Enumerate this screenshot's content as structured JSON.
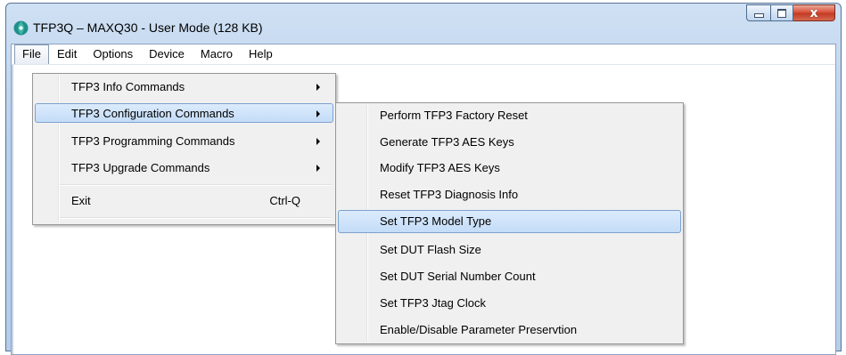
{
  "window": {
    "title": "TFP3Q – MAXQ30 - User Mode (128 KB)",
    "icon": "app-logo-icon",
    "buttons": {
      "minimize": "minimize-icon",
      "maximize": "maximize-icon",
      "close": "close-icon"
    },
    "close_glyph": "x"
  },
  "menubar": {
    "items": [
      {
        "label": "File",
        "active": true
      },
      {
        "label": "Edit"
      },
      {
        "label": "Options"
      },
      {
        "label": "Device"
      },
      {
        "label": "Macro"
      },
      {
        "label": "Help"
      }
    ]
  },
  "file_menu": {
    "items": [
      {
        "label": "TFP3 Info Commands",
        "has_submenu": true
      },
      {
        "label": "TFP3 Configuration Commands",
        "has_submenu": true,
        "highlighted": true
      },
      {
        "label": "TFP3 Programming Commands",
        "has_submenu": true
      },
      {
        "label": "TFP3 Upgrade Commands",
        "has_submenu": true
      },
      {
        "label": "Exit",
        "shortcut": "Ctrl-Q"
      }
    ]
  },
  "config_submenu": {
    "items": [
      {
        "label": "Perform TFP3 Factory Reset"
      },
      {
        "label": "Generate TFP3 AES Keys"
      },
      {
        "label": "Modify TFP3 AES Keys"
      },
      {
        "label": "Reset TFP3 Diagnosis Info"
      },
      {
        "label": "Set TFP3 Model Type",
        "highlighted": true
      },
      {
        "label": "Set DUT Flash Size"
      },
      {
        "label": "Set DUT Serial Number Count"
      },
      {
        "label": "Set TFP3 Jtag Clock"
      },
      {
        "label": "Enable/Disable Parameter Preservtion"
      }
    ]
  },
  "colors": {
    "highlight": "#c4dcf8",
    "frame": "#b9d1ec",
    "close_button": "#c23b23"
  }
}
